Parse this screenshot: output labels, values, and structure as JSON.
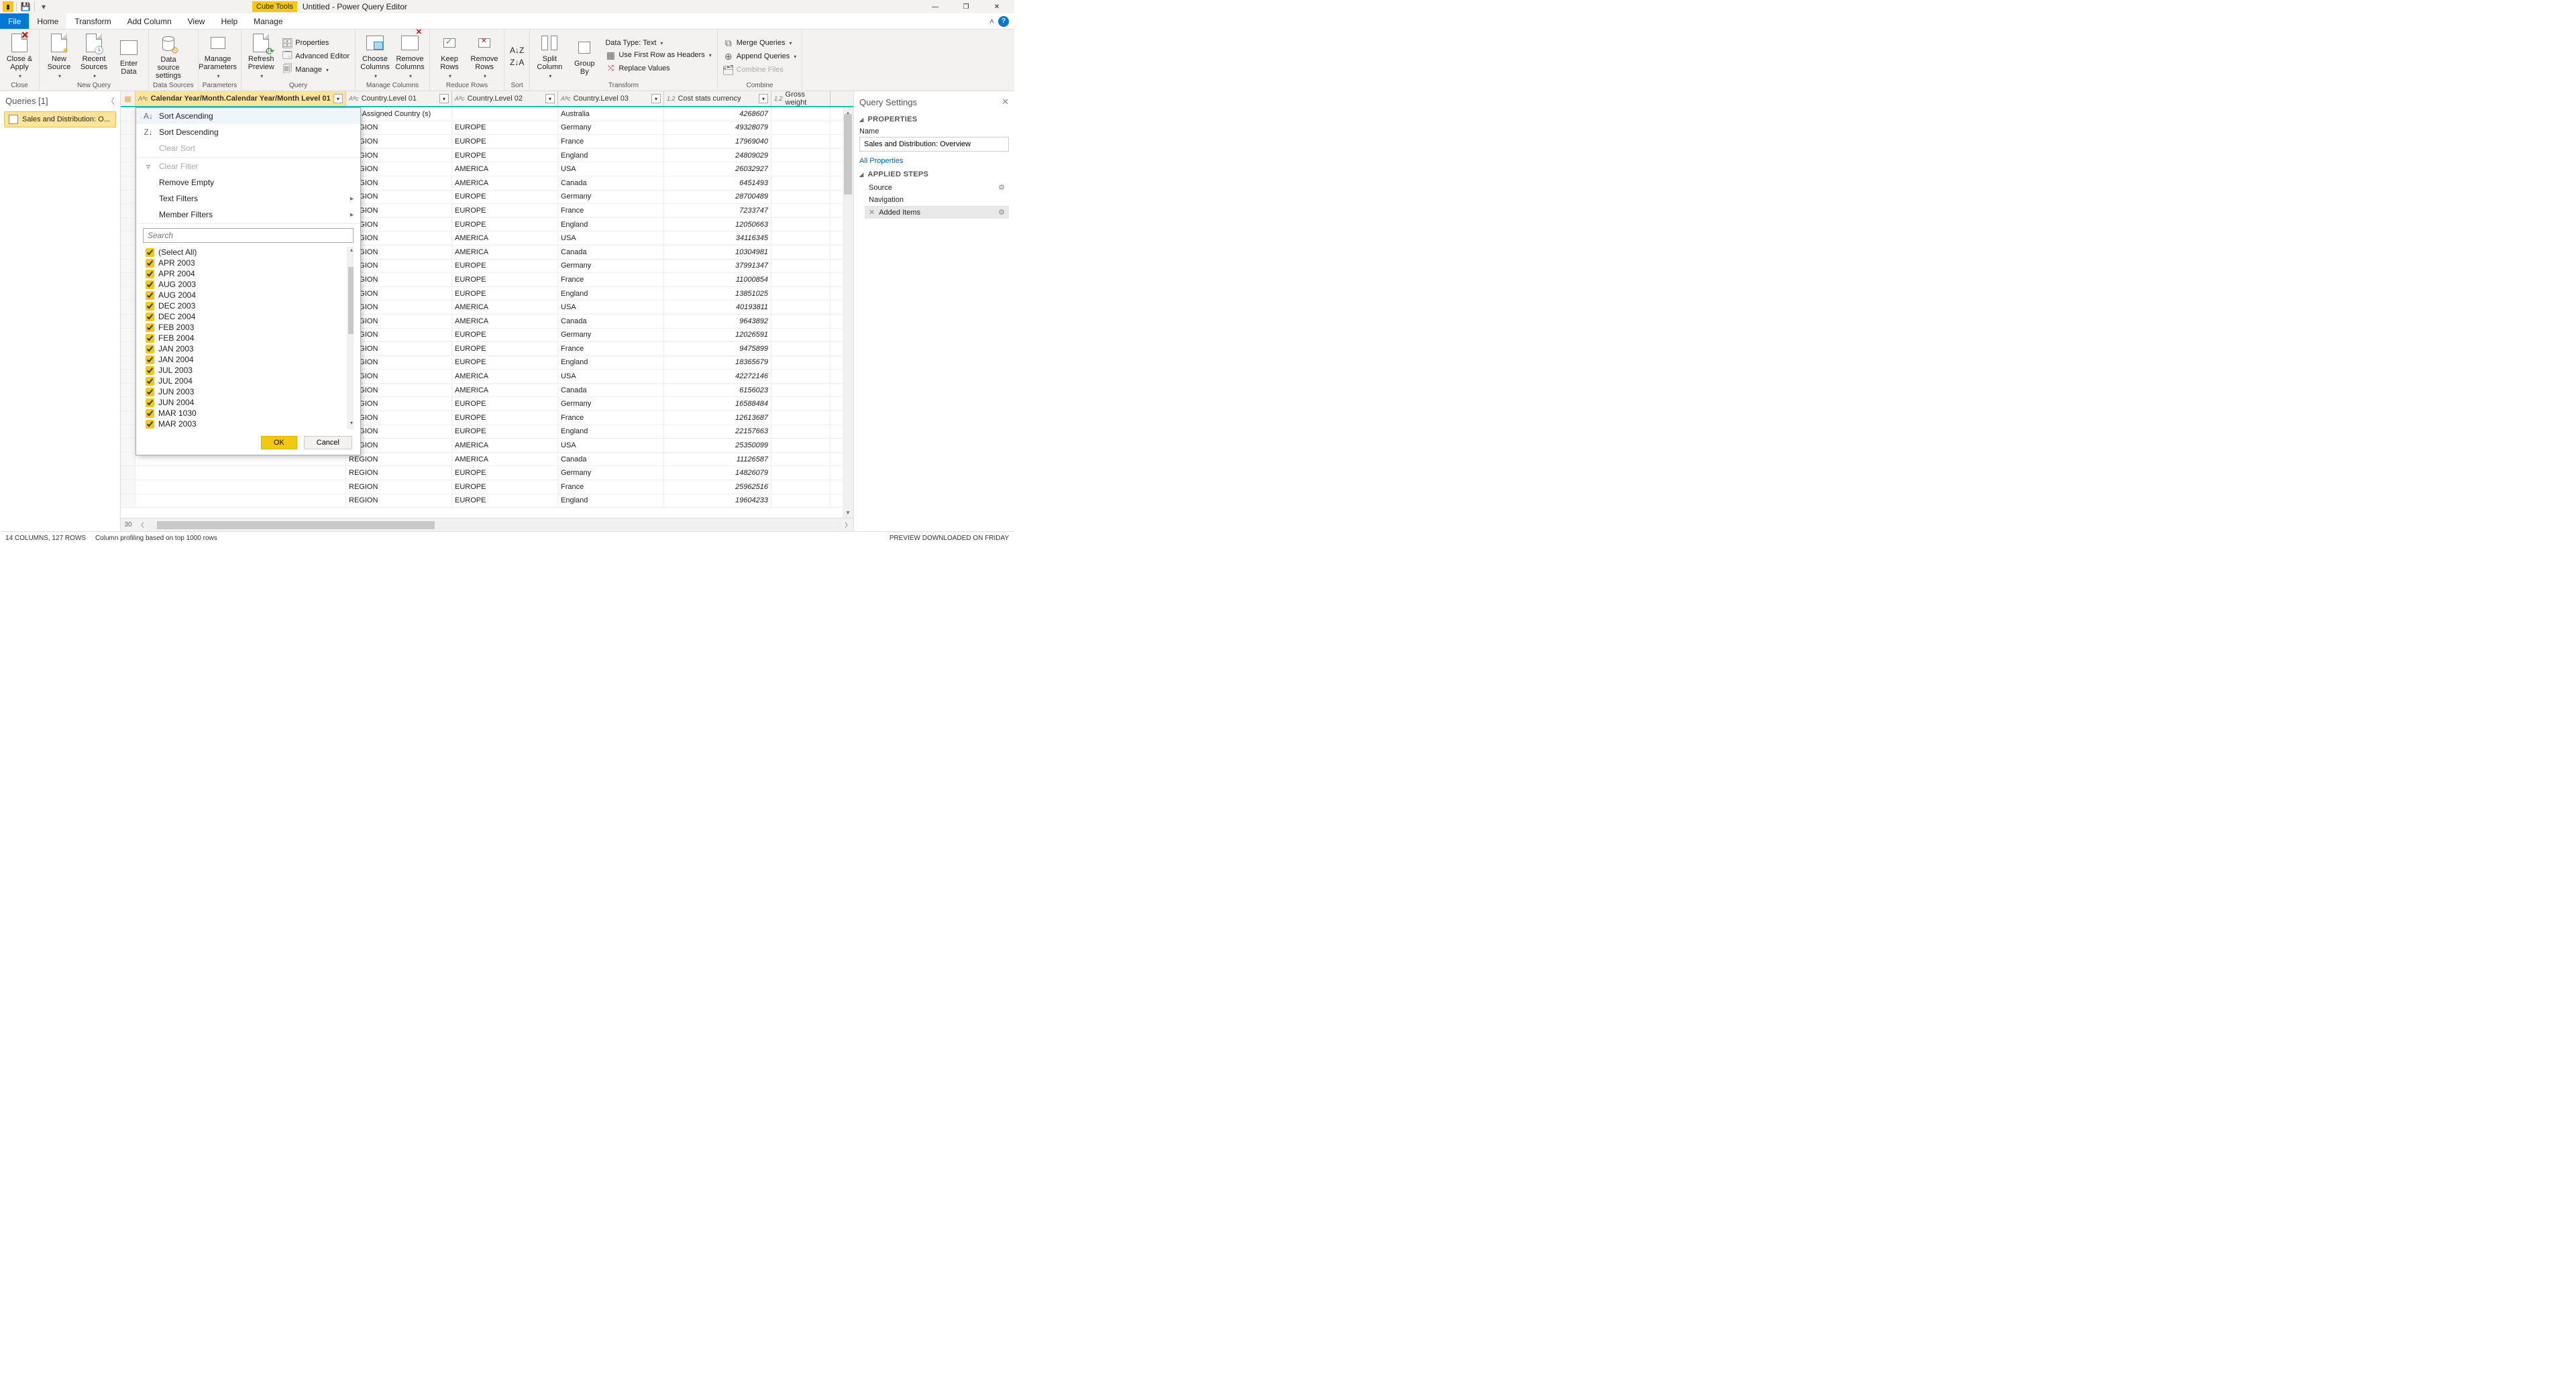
{
  "titlebar": {
    "cube_tools": "Cube Tools",
    "title": "Untitled - Power Query Editor",
    "help_badge": "?"
  },
  "tabs": {
    "file": "File",
    "items": [
      "Home",
      "Transform",
      "Add Column",
      "View",
      "Help",
      "Manage"
    ],
    "active": "Home"
  },
  "ribbon": {
    "close_apply": "Close &\nApply",
    "close_group": "Close",
    "new_source": "New\nSource",
    "recent_sources": "Recent\nSources",
    "enter_data": "Enter\nData",
    "new_query_group": "New Query",
    "data_source_settings": "Data source\nsettings",
    "data_sources_group": "Data Sources",
    "manage_params": "Manage\nParameters",
    "parameters_group": "Parameters",
    "refresh_preview": "Refresh\nPreview",
    "properties": "Properties",
    "advanced_editor": "Advanced Editor",
    "manage": "Manage",
    "query_group": "Query",
    "choose_columns": "Choose\nColumns",
    "remove_columns": "Remove\nColumns",
    "manage_columns_group": "Manage Columns",
    "keep_rows": "Keep\nRows",
    "remove_rows": "Remove\nRows",
    "reduce_rows_group": "Reduce Rows",
    "sort_group": "Sort",
    "split_column": "Split\nColumn",
    "group_by": "Group\nBy",
    "data_type": "Data Type: Text",
    "first_row_headers": "Use First Row as Headers",
    "replace_values": "Replace Values",
    "transform_group": "Transform",
    "merge_queries": "Merge Queries",
    "append_queries": "Append Queries",
    "combine_files": "Combine Files",
    "combine_group": "Combine"
  },
  "queries_panel": {
    "header": "Queries [1]",
    "item": "Sales and Distribution: O..."
  },
  "columns": {
    "c1": "Calendar Year/Month.Calendar Year/Month Level 01",
    "c2": "Country.Level 01",
    "c3": "Country.Level 02",
    "c4": "Country.Level 03",
    "c5": "Cost stats currency",
    "c6": "Gross weight",
    "type_abc": "Aᴮc",
    "type_12": "1.2"
  },
  "filter_popup": {
    "sort_asc": "Sort Ascending",
    "sort_desc": "Sort Descending",
    "clear_sort": "Clear Sort",
    "clear_filter": "Clear Filter",
    "remove_empty": "Remove Empty",
    "text_filters": "Text Filters",
    "member_filters": "Member Filters",
    "search_placeholder": "Search",
    "items": [
      "(Select All)",
      "APR 2003",
      "APR 2004",
      "AUG 2003",
      "AUG 2004",
      "DEC 2003",
      "DEC 2004",
      "FEB 2003",
      "FEB 2004",
      "JAN 2003",
      "JAN 2004",
      "JUL 2003",
      "JUL 2004",
      "JUN 2003",
      "JUN 2004",
      "MAR 1030",
      "MAR 2003"
    ],
    "ok": "OK",
    "cancel": "Cancel"
  },
  "rows": [
    {
      "l1": "Not Assigned Country (s)",
      "l2": "",
      "l3": "Australia",
      "cost": "4268607"
    },
    {
      "l1": "REGION",
      "l2": "EUROPE",
      "l3": "Germany",
      "cost": "49328079"
    },
    {
      "l1": "REGION",
      "l2": "EUROPE",
      "l3": "France",
      "cost": "17969040"
    },
    {
      "l1": "REGION",
      "l2": "EUROPE",
      "l3": "England",
      "cost": "24809029"
    },
    {
      "l1": "REGION",
      "l2": "AMERICA",
      "l3": "USA",
      "cost": "26032927"
    },
    {
      "l1": "REGION",
      "l2": "AMERICA",
      "l3": "Canada",
      "cost": "6451493"
    },
    {
      "l1": "REGION",
      "l2": "EUROPE",
      "l3": "Germany",
      "cost": "28700489"
    },
    {
      "l1": "REGION",
      "l2": "EUROPE",
      "l3": "France",
      "cost": "7233747"
    },
    {
      "l1": "REGION",
      "l2": "EUROPE",
      "l3": "England",
      "cost": "12050663"
    },
    {
      "l1": "REGION",
      "l2": "AMERICA",
      "l3": "USA",
      "cost": "34116345"
    },
    {
      "l1": "REGION",
      "l2": "AMERICA",
      "l3": "Canada",
      "cost": "10304981"
    },
    {
      "l1": "REGION",
      "l2": "EUROPE",
      "l3": "Germany",
      "cost": "37991347"
    },
    {
      "l1": "REGION",
      "l2": "EUROPE",
      "l3": "France",
      "cost": "11000854"
    },
    {
      "l1": "REGION",
      "l2": "EUROPE",
      "l3": "England",
      "cost": "13851025"
    },
    {
      "l1": "REGION",
      "l2": "AMERICA",
      "l3": "USA",
      "cost": "40193811"
    },
    {
      "l1": "REGION",
      "l2": "AMERICA",
      "l3": "Canada",
      "cost": "9643892"
    },
    {
      "l1": "REGION",
      "l2": "EUROPE",
      "l3": "Germany",
      "cost": "12026591"
    },
    {
      "l1": "REGION",
      "l2": "EUROPE",
      "l3": "France",
      "cost": "9475899"
    },
    {
      "l1": "REGION",
      "l2": "EUROPE",
      "l3": "England",
      "cost": "18365679"
    },
    {
      "l1": "REGION",
      "l2": "AMERICA",
      "l3": "USA",
      "cost": "42272146"
    },
    {
      "l1": "REGION",
      "l2": "AMERICA",
      "l3": "Canada",
      "cost": "6156023"
    },
    {
      "l1": "REGION",
      "l2": "EUROPE",
      "l3": "Germany",
      "cost": "16588484"
    },
    {
      "l1": "REGION",
      "l2": "EUROPE",
      "l3": "France",
      "cost": "12613687"
    },
    {
      "l1": "REGION",
      "l2": "EUROPE",
      "l3": "England",
      "cost": "22157663"
    },
    {
      "l1": "REGION",
      "l2": "AMERICA",
      "l3": "USA",
      "cost": "25350099"
    },
    {
      "l1": "REGION",
      "l2": "AMERICA",
      "l3": "Canada",
      "cost": "11126587"
    },
    {
      "l1": "REGION",
      "l2": "EUROPE",
      "l3": "Germany",
      "cost": "14826079"
    },
    {
      "l1": "REGION",
      "l2": "EUROPE",
      "l3": "France",
      "cost": "25962516"
    },
    {
      "l1": "REGION",
      "l2": "EUROPE",
      "l3": "England",
      "cost": "19604233"
    }
  ],
  "query_settings": {
    "header": "Query Settings",
    "properties": "PROPERTIES",
    "name_label": "Name",
    "name_value": "Sales and Distribution: Overview",
    "all_properties": "All Properties",
    "applied_steps": "APPLIED STEPS",
    "steps": [
      "Source",
      "Navigation",
      "Added Items"
    ]
  },
  "statusbar": {
    "left1": "14 COLUMNS, 127 ROWS",
    "left2": "Column profiling based on top 1000 rows",
    "right": "PREVIEW DOWNLOADED ON FRIDAY"
  },
  "hscroll_rownum": "30"
}
